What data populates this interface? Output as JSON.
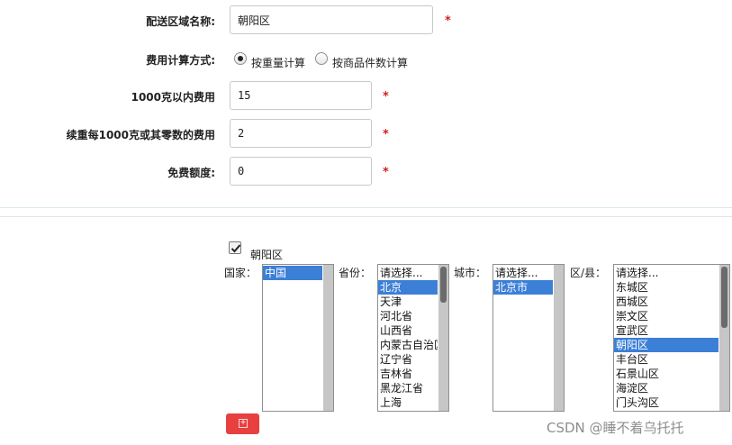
{
  "form": {
    "region_name": {
      "label": "配送区域名称:",
      "value": "朝阳区"
    },
    "fee_method": {
      "label": "费用计算方式:",
      "option_weight": "按重量计算",
      "option_count": "按商品件数计算",
      "selected": "option_weight"
    },
    "fee_1000g": {
      "label": "1000克以内费用",
      "value": "15"
    },
    "fee_continue": {
      "label": "续重每1000克或其零数的费用",
      "value": "2"
    },
    "free_quota": {
      "label": "免费额度:",
      "value": "0"
    },
    "required_mark": "*"
  },
  "region": {
    "checkbox_label": "朝阳区",
    "checkbox_checked": true,
    "country": {
      "label": "国家：",
      "options": [
        "中国"
      ],
      "selected_index": 0
    },
    "province": {
      "label": "省份：",
      "options": [
        "请选择...",
        "北京",
        "天津",
        "河北省",
        "山西省",
        "内蒙古自治区",
        "辽宁省",
        "吉林省",
        "黑龙江省",
        "上海"
      ],
      "selected_index": 1
    },
    "city": {
      "label": "城市：",
      "options": [
        "请选择...",
        "北京市"
      ],
      "selected_index": 1
    },
    "district": {
      "label": "区/县：",
      "options": [
        "请选择...",
        "东城区",
        "西城区",
        "崇文区",
        "宣武区",
        "朝阳区",
        "丰台区",
        "石景山区",
        "海淀区",
        "门头沟区"
      ],
      "selected_index": 5
    },
    "add_button": "+"
  },
  "watermark": "CSDN @睡不着乌托托"
}
